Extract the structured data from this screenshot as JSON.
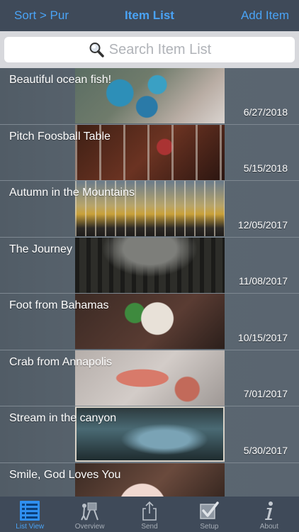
{
  "nav": {
    "left": "Sort > Pur",
    "title": "Item List",
    "right": "Add Item"
  },
  "search": {
    "placeholder": "Search Item List",
    "icon": "magnifier-icon"
  },
  "items": [
    {
      "title": "Beautiful ocean fish!",
      "date": "6/27/2018"
    },
    {
      "title": "Pitch Foosball Table",
      "date": "5/15/2018"
    },
    {
      "title": "Autumn in the Mountains",
      "date": "12/05/2017"
    },
    {
      "title": "The Journey",
      "date": "11/08/2017"
    },
    {
      "title": "Foot from Bahamas",
      "date": "10/15/2017"
    },
    {
      "title": "Crab from Annapolis",
      "date": "7/01/2017"
    },
    {
      "title": "Stream in the canyon",
      "date": "5/30/2017"
    },
    {
      "title": "Smile, God Loves You",
      "date": ""
    }
  ],
  "tabs": [
    {
      "label": "List View",
      "icon": "list-icon",
      "active": true
    },
    {
      "label": "Overview",
      "icon": "easel-icon",
      "active": false
    },
    {
      "label": "Send",
      "icon": "share-icon",
      "active": false
    },
    {
      "label": "Setup",
      "icon": "checkbox-icon",
      "active": false
    },
    {
      "label": "About",
      "icon": "info-icon",
      "active": false
    }
  ],
  "colors": {
    "accent": "#4aa3f5",
    "bar": "#3f4a59",
    "inactive": "#a6adb6"
  }
}
